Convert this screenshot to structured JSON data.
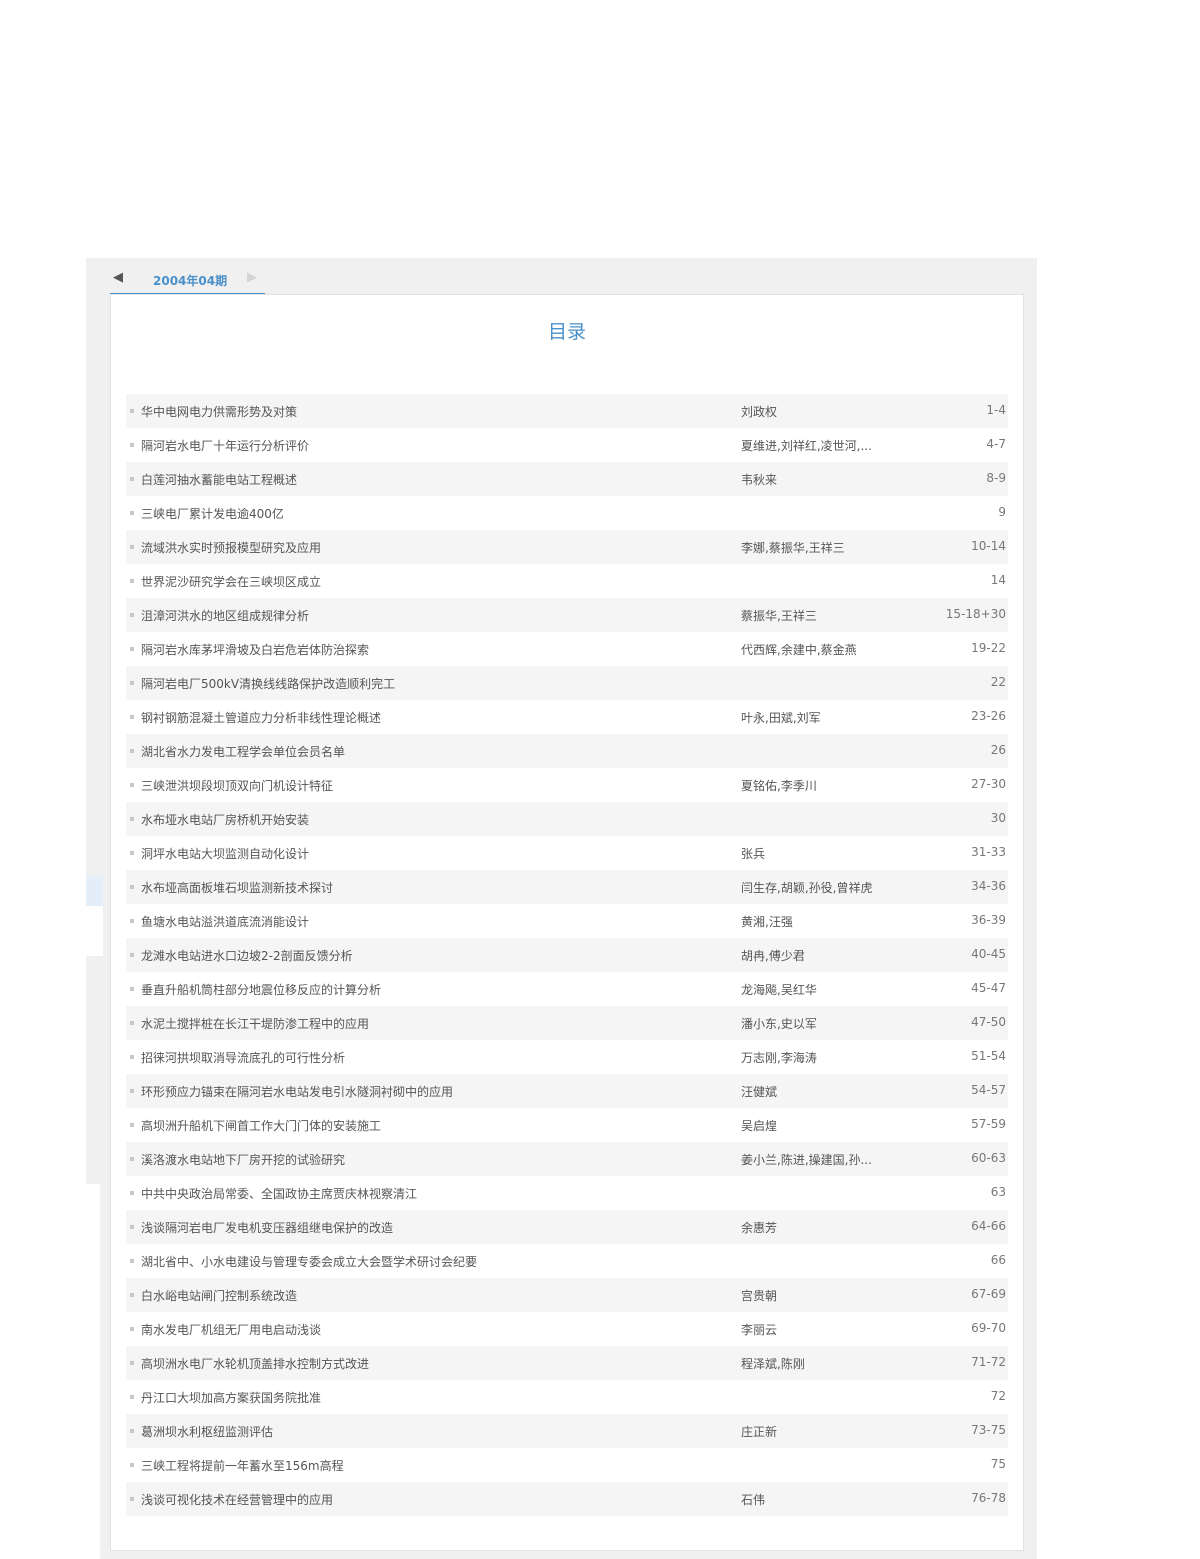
{
  "issue_tab": {
    "label": "2004年04期",
    "prev_icon": "triangle-left-icon",
    "next_icon": "triangle-right-icon"
  },
  "toc_title": "目录",
  "articles": [
    {
      "title": "华中电网电力供需形势及对策",
      "authors": "刘政权",
      "pages": "1-4"
    },
    {
      "title": "隔河岩水电厂十年运行分析评价",
      "authors": "夏维进,刘祥红,凌世河,...",
      "pages": "4-7"
    },
    {
      "title": "白莲河抽水蓄能电站工程概述",
      "authors": "韦秋来",
      "pages": "8-9"
    },
    {
      "title": "三峡电厂累计发电逾400亿",
      "authors": "",
      "pages": "9"
    },
    {
      "title": "流域洪水实时预报模型研究及应用",
      "authors": "李娜,蔡振华,王祥三",
      "pages": "10-14"
    },
    {
      "title": "世界泥沙研究学会在三峡坝区成立",
      "authors": "",
      "pages": "14"
    },
    {
      "title": "沮漳河洪水的地区组成规律分析",
      "authors": "蔡振华,王祥三",
      "pages": "15-18+30"
    },
    {
      "title": "隔河岩水库茅坪滑坡及白岩危岩体防治探索",
      "authors": "代西辉,余建中,蔡金燕",
      "pages": "19-22"
    },
    {
      "title": "隔河岩电厂500kV清换线线路保护改造顺利完工",
      "authors": "",
      "pages": "22"
    },
    {
      "title": "钢衬钢筋混凝土管道应力分析非线性理论概述",
      "authors": "叶永,田斌,刘军",
      "pages": "23-26"
    },
    {
      "title": "湖北省水力发电工程学会单位会员名单",
      "authors": "",
      "pages": "26"
    },
    {
      "title": "三峡泄洪坝段坝顶双向门机设计特征",
      "authors": "夏铭佑,李季川",
      "pages": "27-30"
    },
    {
      "title": "水布垭水电站厂房桥机开始安装",
      "authors": "",
      "pages": "30"
    },
    {
      "title": "洞坪水电站大坝监测自动化设计",
      "authors": "张兵",
      "pages": "31-33"
    },
    {
      "title": "水布垭高面板堆石坝监测新技术探讨",
      "authors": "闫生存,胡颖,孙役,曾祥虎",
      "pages": "34-36"
    },
    {
      "title": "鱼塘水电站溢洪道底流消能设计",
      "authors": "黄湘,汪强",
      "pages": "36-39"
    },
    {
      "title": "龙滩水电站进水口边坡2-2剖面反馈分析",
      "authors": "胡冉,傅少君",
      "pages": "40-45"
    },
    {
      "title": "垂直升船机筒柱部分地震位移反应的计算分析",
      "authors": "龙海飚,吴红华",
      "pages": "45-47"
    },
    {
      "title": "水泥土搅拌桩在长江干堤防渗工程中的应用",
      "authors": "潘小东,史以军",
      "pages": "47-50"
    },
    {
      "title": "招徕河拱坝取消导流底孔的可行性分析",
      "authors": "万志刚,李海涛",
      "pages": "51-54"
    },
    {
      "title": "环形预应力锚束在隔河岩水电站发电引水隧洞衬砌中的应用",
      "authors": "汪健斌",
      "pages": "54-57"
    },
    {
      "title": "高坝洲升船机下闸首工作大门门体的安装施工",
      "authors": "吴启煌",
      "pages": "57-59"
    },
    {
      "title": "溪洛渡水电站地下厂房开挖的试验研究",
      "authors": "姜小兰,陈进,操建国,孙...",
      "pages": "60-63"
    },
    {
      "title": "中共中央政治局常委、全国政协主席贾庆林视察清江",
      "authors": "",
      "pages": "63"
    },
    {
      "title": "浅谈隔河岩电厂发电机变压器组继电保护的改造",
      "authors": "余惠芳",
      "pages": "64-66"
    },
    {
      "title": "湖北省中、小水电建设与管理专委会成立大会暨学术研讨会纪要",
      "authors": "",
      "pages": "66"
    },
    {
      "title": "白水峪电站闸门控制系统改造",
      "authors": "宫贵朝",
      "pages": "67-69"
    },
    {
      "title": "南水发电厂机组无厂用电启动浅谈",
      "authors": "李丽云",
      "pages": "69-70"
    },
    {
      "title": "高坝洲水电厂水轮机顶盖排水控制方式改进",
      "authors": "程泽斌,陈刚",
      "pages": "71-72"
    },
    {
      "title": "丹江口大坝加高方案获国务院批准",
      "authors": "",
      "pages": "72"
    },
    {
      "title": "葛洲坝水利枢纽监测评估",
      "authors": "庄正新",
      "pages": "73-75"
    },
    {
      "title": "三峡工程将提前一年蓄水至156m高程",
      "authors": "",
      "pages": "75"
    },
    {
      "title": "浅谈可视化技术在经营管理中的应用",
      "authors": "石伟",
      "pages": "76-78"
    }
  ],
  "colors": {
    "accent": "#4a90c9",
    "row_stripe": "#f5f5f5",
    "outer_background": "#f0f0f0",
    "text": "#555555"
  }
}
